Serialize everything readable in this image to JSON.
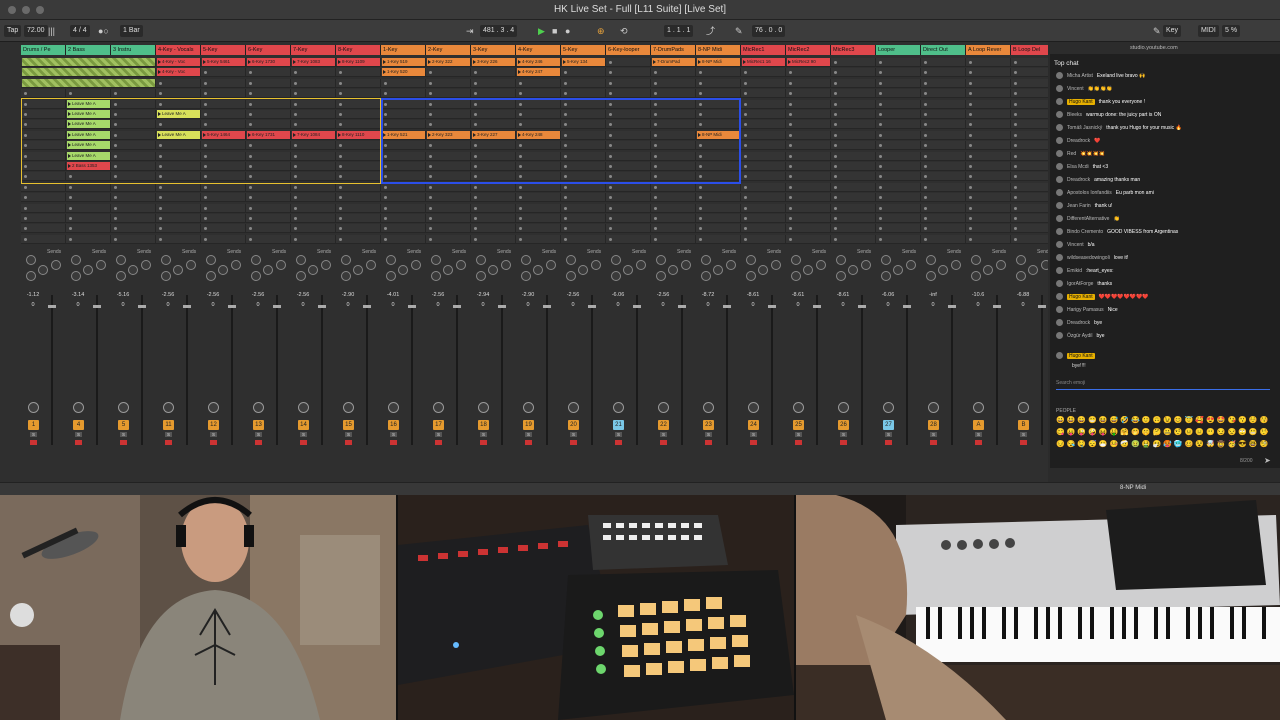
{
  "window": {
    "title": "HK Live Set - Full  [L11 Suite]  [Live Set]"
  },
  "transport": {
    "tap": "Tap",
    "tempo": "72.00",
    "time_signature": "4 / 4",
    "quantize": "1 Bar",
    "position": "481 .  3 .  4",
    "loop_start": "1 .  1 .  1",
    "loop_length": "76 .  0 .  0",
    "key_label": "Key",
    "midi_label": "MIDI",
    "cpu": "5 %"
  },
  "tracks": [
    {
      "name": "Drums / Pe",
      "color": "#4fbf8a"
    },
    {
      "name": "2 Bass",
      "color": "#4fbf8a"
    },
    {
      "name": "3 Instru",
      "color": "#4fbf8a"
    },
    {
      "name": "4-Key - Vocals",
      "color": "#e0474c"
    },
    {
      "name": "5-Key",
      "color": "#e0474c"
    },
    {
      "name": "6-Key",
      "color": "#e0474c"
    },
    {
      "name": "7-Key",
      "color": "#e0474c"
    },
    {
      "name": "8-Key",
      "color": "#e0474c"
    },
    {
      "name": "1-Key",
      "color": "#e9883b"
    },
    {
      "name": "2-Key",
      "color": "#e9883b"
    },
    {
      "name": "3-Key",
      "color": "#e9883b"
    },
    {
      "name": "4-Key",
      "color": "#e9883b"
    },
    {
      "name": "5-Key",
      "color": "#e9883b"
    },
    {
      "name": "6-Key-looper",
      "color": "#e9883b"
    },
    {
      "name": "7-DrumPads",
      "color": "#e9883b"
    },
    {
      "name": "8-NP Midi",
      "color": "#e9883b"
    },
    {
      "name": "MicRec1",
      "color": "#e0474c"
    },
    {
      "name": "MicRec2",
      "color": "#e0474c"
    },
    {
      "name": "MicRec3",
      "color": "#e0474c"
    },
    {
      "name": "Looper",
      "color": "#4fbf8a"
    },
    {
      "name": "Direct Out",
      "color": "#4fbf8a"
    },
    {
      "name": "A Loop Rever",
      "color": "#e9883b"
    },
    {
      "name": "B Loop Del",
      "color": "#e0474c"
    }
  ],
  "clips": [
    {
      "track": 1,
      "row": 0,
      "name": "The Earth O",
      "color": "#a7d96a"
    },
    {
      "track": 1,
      "row": 1,
      "name": "The Earth O",
      "color": "#a7d96a"
    },
    {
      "track": 1,
      "row": 2,
      "name": "The Earth O",
      "color": "#a7d96a"
    },
    {
      "track": 3,
      "row": 0,
      "name": "4-Key - Voc",
      "color": "#e0474c"
    },
    {
      "track": 3,
      "row": 1,
      "name": "4-Key - Voc",
      "color": "#e0474c"
    },
    {
      "track": 4,
      "row": 0,
      "name": "5-Key 5461",
      "color": "#e0474c"
    },
    {
      "track": 5,
      "row": 0,
      "name": "6-Key 1730",
      "color": "#e0474c"
    },
    {
      "track": 6,
      "row": 0,
      "name": "7-Key 1083",
      "color": "#e0474c"
    },
    {
      "track": 7,
      "row": 0,
      "name": "8-Key 1109",
      "color": "#e0474c"
    },
    {
      "track": 8,
      "row": 0,
      "name": "1-Key 519",
      "color": "#e9883b"
    },
    {
      "track": 8,
      "row": 1,
      "name": "1-Key 520",
      "color": "#e9883b"
    },
    {
      "track": 9,
      "row": 0,
      "name": "2-Key 322",
      "color": "#e9883b"
    },
    {
      "track": 10,
      "row": 0,
      "name": "3-Key 226",
      "color": "#e9883b"
    },
    {
      "track": 11,
      "row": 0,
      "name": "4-Key 246",
      "color": "#e9883b"
    },
    {
      "track": 11,
      "row": 1,
      "name": "4-Key 247",
      "color": "#e9883b"
    },
    {
      "track": 12,
      "row": 0,
      "name": "5-Key 134",
      "color": "#e9883b"
    },
    {
      "track": 14,
      "row": 0,
      "name": "7-DrumPad",
      "color": "#e9883b"
    },
    {
      "track": 15,
      "row": 0,
      "name": "8-NP Midi",
      "color": "#e9883b"
    },
    {
      "track": 16,
      "row": 0,
      "name": "MicRec1 16",
      "color": "#e0474c"
    },
    {
      "track": 17,
      "row": 0,
      "name": "MicRec2 90",
      "color": "#e0474c"
    },
    {
      "track": 1,
      "row": 4,
      "name": "Leave Me A",
      "color": "#a7d96a"
    },
    {
      "track": 1,
      "row": 5,
      "name": "Leave Me A",
      "color": "#a7d96a"
    },
    {
      "track": 1,
      "row": 6,
      "name": "Leave Me A",
      "color": "#a7d96a"
    },
    {
      "track": 1,
      "row": 7,
      "name": "Leave Me A",
      "color": "#a7d96a"
    },
    {
      "track": 1,
      "row": 8,
      "name": "Leave Me A",
      "color": "#a7d96a"
    },
    {
      "track": 1,
      "row": 9,
      "name": "Leave Me A",
      "color": "#a7d96a"
    },
    {
      "track": 3,
      "row": 5,
      "name": "Leave Me A",
      "color": "#d8e05a"
    },
    {
      "track": 3,
      "row": 7,
      "name": "Leave Me A",
      "color": "#d8e05a"
    },
    {
      "track": 4,
      "row": 7,
      "name": "5-Key 1464",
      "color": "#e0474c"
    },
    {
      "track": 5,
      "row": 7,
      "name": "6-Key 1731",
      "color": "#e0474c"
    },
    {
      "track": 6,
      "row": 7,
      "name": "7-Key 1084",
      "color": "#e0474c"
    },
    {
      "track": 7,
      "row": 7,
      "name": "8-Key 1110",
      "color": "#e0474c"
    },
    {
      "track": 8,
      "row": 7,
      "name": "1-Key 521",
      "color": "#e9883b"
    },
    {
      "track": 9,
      "row": 7,
      "name": "2-Key 323",
      "color": "#e9883b"
    },
    {
      "track": 10,
      "row": 7,
      "name": "3-Key 227",
      "color": "#e9883b"
    },
    {
      "track": 11,
      "row": 7,
      "name": "4-Key 248",
      "color": "#e9883b"
    },
    {
      "track": 15,
      "row": 7,
      "name": "8-NP Midi",
      "color": "#e9883b"
    },
    {
      "track": 1,
      "row": 10,
      "name": "2 Bass 1353",
      "color": "#e0474c"
    }
  ],
  "mixer": {
    "sends_label": "Sends",
    "volumes": [
      "-1.12",
      "-3.14",
      "-5.16",
      "-2.56",
      "-2.56",
      "-2.56",
      "-2.56",
      "-2.90",
      "-4.01",
      "-2.56",
      "-2.94",
      "-2.90",
      "-2.56",
      "-6.06",
      "-2.56",
      "-8.72",
      "-8.61",
      "-8.61",
      "-8.61",
      "-6.06",
      "-inf",
      "-10.6",
      "-6.88"
    ],
    "zero": "0",
    "track_numbers": [
      "1",
      "4",
      "5",
      "11",
      "12",
      "13",
      "14",
      "15",
      "16",
      "17",
      "18",
      "19",
      "20",
      "21",
      "22",
      "23",
      "24",
      "25",
      "26",
      "27",
      "28",
      "A",
      "B"
    ],
    "solo_label": "S"
  },
  "status": {
    "selected_track": "8-NP Midi"
  },
  "chat": {
    "url": "studio.youtube.com",
    "header": "Top chat",
    "messages": [
      {
        "author": "Micha Artist",
        "text": "Exeland live bravo 🙌"
      },
      {
        "author": "Vincent",
        "text": "👏👏👏👏"
      },
      {
        "author": "Hugo Kant",
        "text": "thank you everyone !",
        "own": true
      },
      {
        "author": "Bleeks",
        "text": "warmup done: the juicy part is ON"
      },
      {
        "author": "Tomáš Jasnický",
        "text": "thank you Hugo for your music 🔥"
      },
      {
        "author": "Dreadrock",
        "text": "❤️"
      },
      {
        "author": "Red",
        "text": "💥💥💥💥"
      },
      {
        "author": "Elsa Mcdi",
        "text": "that <3"
      },
      {
        "author": "Dreadrock",
        "text": "amazing thanks man"
      },
      {
        "author": "Apostolos Ionfandiis",
        "text": "Eu parb mon ami"
      },
      {
        "author": "Jean Farin",
        "text": "thank u!"
      },
      {
        "author": "DifferentAlternative",
        "text": "👏"
      },
      {
        "author": "Bindo Cremento",
        "text": "GOOD VIBESS from Argentinas"
      },
      {
        "author": "Vincent",
        "text": "b/a"
      },
      {
        "author": "wildseasedowingoli",
        "text": "love it!"
      },
      {
        "author": "Emikid",
        "text": ":heart_eyes:"
      },
      {
        "author": "IgorAtForge",
        "text": "thanks"
      },
      {
        "author": "Hugo Kant",
        "text": "❤️❤️❤️❤️❤️❤️❤️❤️",
        "own": true,
        "hearts": true
      },
      {
        "author": "Harigy Pamasus",
        "text": "Nice"
      },
      {
        "author": "Dreadrock",
        "text": "bye"
      },
      {
        "author": "Özgür Aydil",
        "text": "bye"
      }
    ],
    "pending_author": "Hugo Kant",
    "pending_text": "bye!!!!",
    "input_placeholder": "Search emoji",
    "people_label": "PEOPLE",
    "char_count": "8/200",
    "emoji_rows": [
      "😀😃😄😁😆😅🤣😂🙂🙃😉😊😇🥰😍🤩😘😗☺️😚😙",
      "😋😛😜🤪😝🤑🤗🤭🤫🤔🤐🤨😐😑😶😏😒🙄😬🤥😌",
      "😔😪🤤😴😷🤒🤕🤢🤮🤧🥵🥶🥴😵🤯🤠🥳😎🤓🧐😕"
    ]
  }
}
